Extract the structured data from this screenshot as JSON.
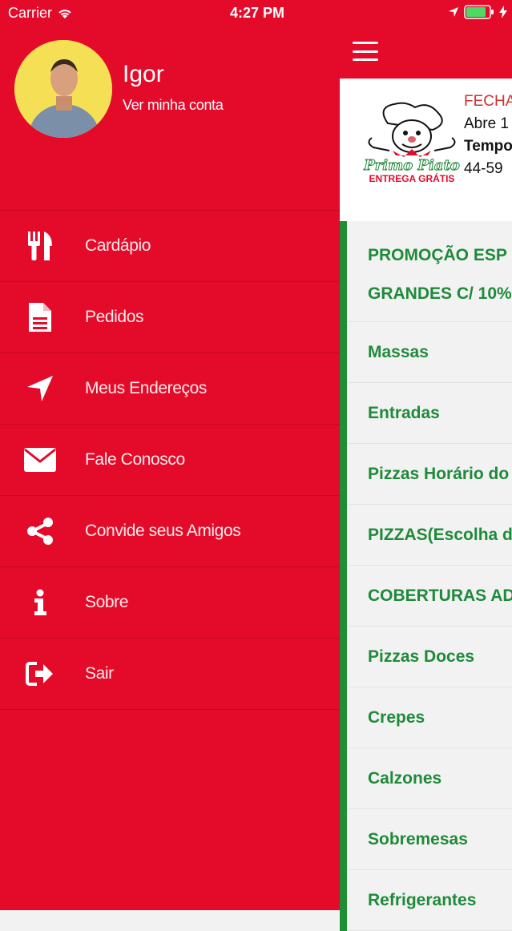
{
  "status_bar": {
    "carrier": "Carrier",
    "time": "4:27 PM"
  },
  "profile": {
    "name": "Igor",
    "account_link": "Ver minha conta"
  },
  "menu": {
    "items": [
      {
        "label": "Cardápio",
        "icon": "fork-knife-icon"
      },
      {
        "label": "Pedidos",
        "icon": "document-icon"
      },
      {
        "label": "Meus Endereços",
        "icon": "location-arrow-icon"
      },
      {
        "label": "Fale Conosco",
        "icon": "envelope-icon"
      },
      {
        "label": "Convide seus Amigos",
        "icon": "share-icon"
      },
      {
        "label": "Sobre",
        "icon": "info-icon"
      },
      {
        "label": "Sair",
        "icon": "sign-out-icon"
      }
    ]
  },
  "restaurant": {
    "status": "FECHA",
    "opens": "Abre 1",
    "delivery": "Tempo",
    "time": "44-59",
    "logo_text": "Primo Piato",
    "logo_tagline": "ENTREGA GRÁTIS"
  },
  "categories": [
    "PROMOÇÃO ESP",
    "GRANDES C/ 10%",
    "Massas",
    "Entradas",
    "Pizzas Horário do",
    "PIZZAS(Escolha d",
    "COBERTURAS AD",
    "Pizzas Doces",
    "Crepes",
    "Calzones",
    "Sobremesas",
    "Refrigerantes"
  ],
  "colors": {
    "brand_red": "#e30b29",
    "category_green": "#1f8a3a"
  }
}
